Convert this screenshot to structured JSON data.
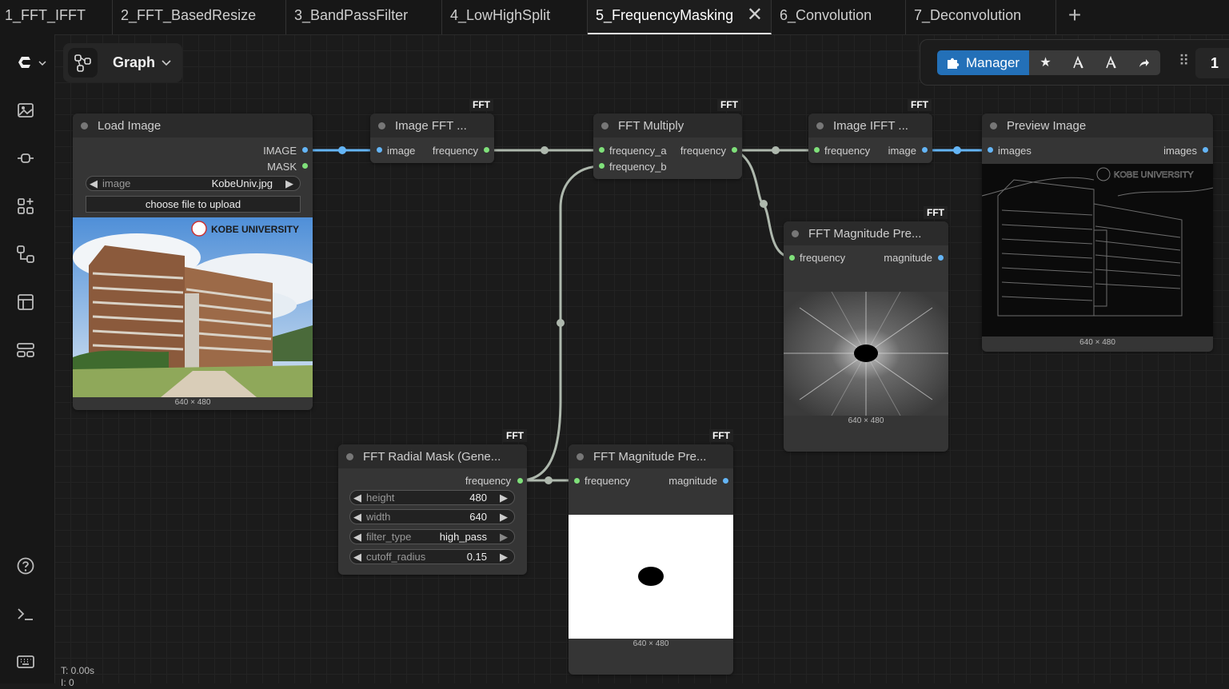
{
  "tabs": [
    {
      "label": "1_FFT_IFFT"
    },
    {
      "label": "2_FFT_BasedResize"
    },
    {
      "label": "3_BandPassFilter"
    },
    {
      "label": "4_LowHighSplit"
    },
    {
      "label": "5_FrequencyMasking",
      "active": true
    },
    {
      "label": "6_Convolution"
    },
    {
      "label": "7_Deconvolution"
    }
  ],
  "tab_add": "+",
  "tab_close": "✕",
  "graph_menu": {
    "label": "Graph"
  },
  "toolbar": {
    "manager_label": "Manager",
    "queue_count": "1"
  },
  "nodes": {
    "load_image": {
      "title": "Load Image",
      "outputs": [
        "IMAGE",
        "MASK"
      ],
      "widget_name": "image",
      "widget_value": "KobeUniv.jpg",
      "upload_label": "choose file to upload",
      "image_text": "KOBE UNIVERSITY",
      "dims": "640 × 480"
    },
    "image_fft": {
      "title": "Image FFT ...",
      "badge": "FFT",
      "input": "image",
      "output": "frequency"
    },
    "fft_multiply": {
      "title": "FFT Multiply",
      "badge": "FFT",
      "input_a": "frequency_a",
      "input_b": "frequency_b",
      "output": "frequency"
    },
    "image_ifft": {
      "title": "Image IFFT ...",
      "badge": "FFT",
      "input": "frequency",
      "output": "image"
    },
    "preview_image": {
      "title": "Preview Image",
      "input": "images",
      "output": "images",
      "image_text": "KOBE UNIVERSITY",
      "dims": "640 × 480"
    },
    "fft_mag_1": {
      "title": "FFT Magnitude Pre...",
      "badge": "FFT",
      "input": "frequency",
      "output": "magnitude",
      "dims": "640 × 480"
    },
    "radial_mask": {
      "title": "FFT Radial Mask (Gene...",
      "badge": "FFT",
      "output": "frequency",
      "widgets": [
        {
          "name": "height",
          "value": "480"
        },
        {
          "name": "width",
          "value": "640"
        },
        {
          "name": "filter_type",
          "value": "high_pass"
        },
        {
          "name": "cutoff_radius",
          "value": "0.15"
        }
      ]
    },
    "fft_mag_2": {
      "title": "FFT Magnitude Pre...",
      "badge": "FFT",
      "input": "frequency",
      "output": "magnitude",
      "dims": "640 × 480"
    }
  },
  "footer": {
    "line1": "T: 0.00s",
    "line2": "I: 0"
  },
  "colors": {
    "accent": "#2370b8",
    "image_link": "#64b5f6",
    "freq_link": "#aeb8ad",
    "freq_pin": "#7fe07a"
  }
}
